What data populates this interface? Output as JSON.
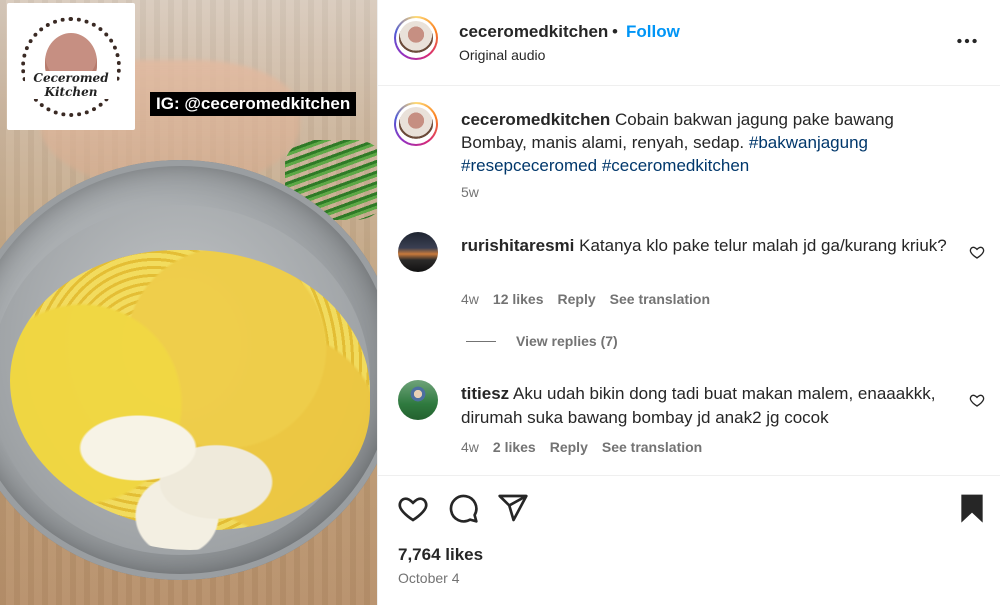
{
  "media": {
    "logo_text": "Ceceromed Kitchen",
    "overlay_handle": "IG: @ceceromedkitchen"
  },
  "header": {
    "username": "ceceromedkitchen",
    "separator": "•",
    "follow_label": "Follow",
    "audio_label": "Original audio",
    "more_icon": "more-horizontal-icon"
  },
  "caption": {
    "username": "ceceromedkitchen",
    "text": "Cobain bakwan jagung pake bawang Bombay, manis alami, renyah, sedap.",
    "hashtags": [
      "#bakwanjagung",
      "#resepceceromed",
      "#ceceromedkitchen"
    ],
    "time": "5w"
  },
  "comments": [
    {
      "username": "rurishitaresmi",
      "text": "Katanya klo pake telur malah jd ga/kurang kriuk?",
      "time": "4w",
      "likes": "12 likes",
      "reply_label": "Reply",
      "translate_label": "See translation",
      "view_replies": "View replies (7)"
    },
    {
      "username": "titiesz",
      "text": "Aku udah bikin dong tadi buat makan malem, enaaakkk, dirumah suka bawang bombay jd anak2 jg cocok",
      "time": "4w",
      "likes": "2 likes",
      "reply_label": "Reply",
      "translate_label": "See translation"
    }
  ],
  "actions": {
    "like_icon": "heart-icon",
    "comment_icon": "comment-icon",
    "share_icon": "send-icon",
    "save_icon": "bookmark-icon",
    "likes_count": "7,764 likes",
    "date": "October 4"
  },
  "colors": {
    "accent": "#0095f6",
    "hashtag": "#00376b",
    "secondary_text": "#737373",
    "primary_text": "#262626"
  }
}
